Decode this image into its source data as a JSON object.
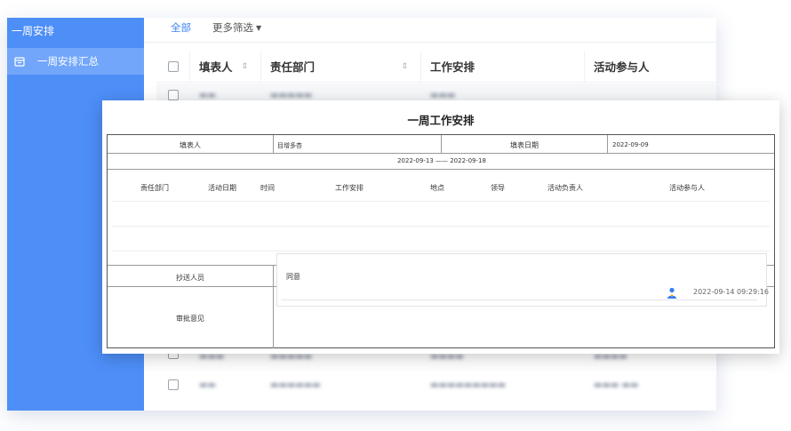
{
  "sidebar": {
    "header": "一周安排",
    "items": [
      {
        "label": "一周安排汇总",
        "icon": "calendar-icon"
      }
    ]
  },
  "tabs": [
    {
      "label": "全部",
      "active": true
    },
    {
      "label": "更多筛选",
      "active": false,
      "icon": "caret-down-icon"
    }
  ],
  "table": {
    "columns": [
      "填表人",
      "责任部门",
      "工作安排",
      "活动参与人"
    ]
  },
  "form": {
    "title": "一周工作安排",
    "filler_label": "填表人",
    "filler_value": "目增多杏",
    "fill_date_label": "填表日期",
    "fill_date_value": "2022-09-09",
    "period": "2022-09-13 —— 2022-09-18",
    "columns": [
      "责任部门",
      "活动日期",
      "时间",
      "工作安排",
      "地点",
      "领导",
      "活动负责人",
      "活动参与人"
    ],
    "cc_label": "抄送人员",
    "approval_label": "审批意见",
    "approval_text": "同意",
    "approval_time": "2022-09-14 09:29:16"
  },
  "colors": {
    "sidebar_bg": "#4d8ef7",
    "accent": "#3a83f7"
  }
}
